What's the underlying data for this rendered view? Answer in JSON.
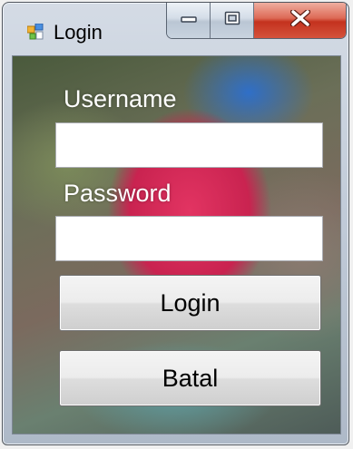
{
  "window": {
    "title": "Login",
    "icon": "windows-form-icon"
  },
  "caption_buttons": {
    "minimize_icon": "minimize-icon",
    "maximize_icon": "maximize-icon",
    "close_icon": "close-icon"
  },
  "form": {
    "username_label": "Username",
    "username_value": "",
    "password_label": "Password",
    "password_value": "",
    "login_button": "Login",
    "cancel_button": "Batal"
  },
  "colors": {
    "close_button": "#c4321e",
    "title_bar": "#c2ccd9"
  }
}
